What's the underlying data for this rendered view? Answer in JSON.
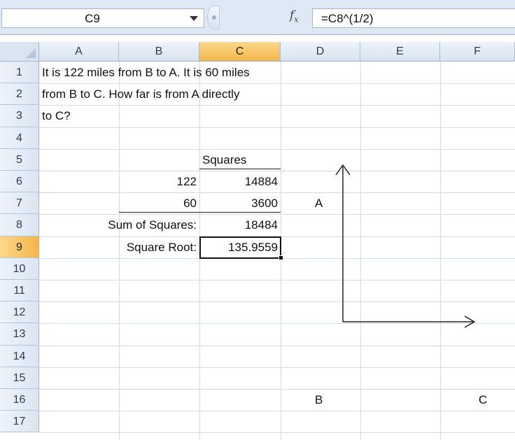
{
  "formula_bar": {
    "name_box": "C9",
    "fx_label": "f",
    "fx_sub": "x",
    "formula": "=C8^(1/2)"
  },
  "columns": [
    "A",
    "B",
    "C",
    "D",
    "E",
    "F"
  ],
  "rows": [
    "1",
    "2",
    "3",
    "4",
    "5",
    "6",
    "7",
    "8",
    "9",
    "10",
    "11",
    "12",
    "13",
    "14",
    "15",
    "16",
    "17"
  ],
  "selected": {
    "column": "C",
    "row": "9"
  },
  "cells": {
    "A1": "It is 122 miles from B to A. It is 60 miles",
    "A2": "from B to C. How far is from A directly",
    "A3": "to C?",
    "C5": "Squares",
    "B6": "122",
    "C6": "14884",
    "B7": "60",
    "C7": "3600",
    "B8": "Sum of Squares:",
    "C8": "18484",
    "B9": "Square Root:",
    "C9": "135.9559"
  },
  "diagram": {
    "label_a": "A",
    "label_b": "B",
    "label_c": "C"
  }
}
